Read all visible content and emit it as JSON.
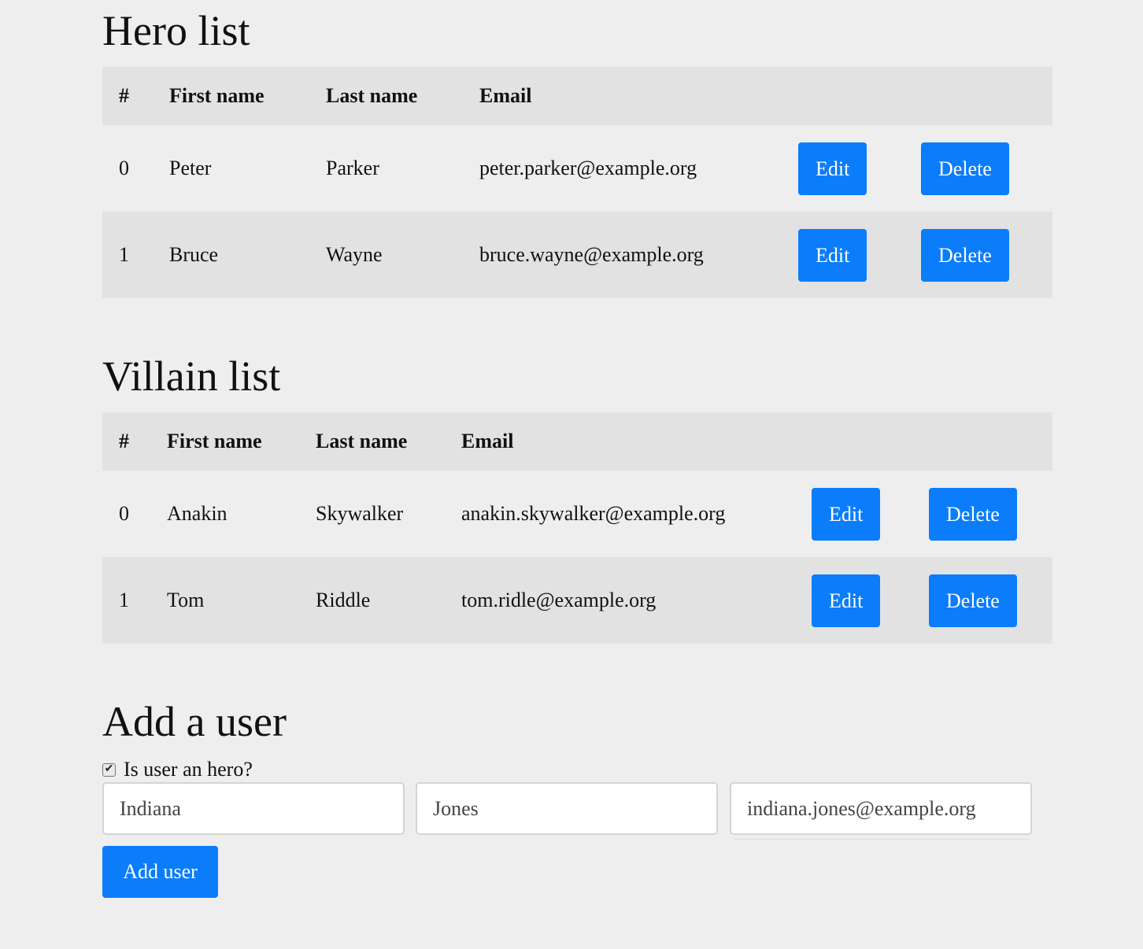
{
  "hero_section": {
    "title": "Hero list",
    "headers": [
      "#",
      "First name",
      "Last name",
      "Email"
    ],
    "rows": [
      {
        "index": "0",
        "first": "Peter",
        "last": "Parker",
        "email": "peter.parker@example.org",
        "edit": "Edit",
        "delete": "Delete"
      },
      {
        "index": "1",
        "first": "Bruce",
        "last": "Wayne",
        "email": "bruce.wayne@example.org",
        "edit": "Edit",
        "delete": "Delete"
      }
    ]
  },
  "villain_section": {
    "title": "Villain list",
    "headers": [
      "#",
      "First name",
      "Last name",
      "Email"
    ],
    "rows": [
      {
        "index": "0",
        "first": "Anakin",
        "last": "Skywalker",
        "email": "anakin.skywalker@example.org",
        "edit": "Edit",
        "delete": "Delete"
      },
      {
        "index": "1",
        "first": "Tom",
        "last": "Riddle",
        "email": "tom.ridle@example.org",
        "edit": "Edit",
        "delete": "Delete"
      }
    ]
  },
  "add_section": {
    "title": "Add a user",
    "hero_checkbox_label": "Is user an hero?",
    "hero_checked": true,
    "first_name_value": "Indiana",
    "last_name_value": "Jones",
    "email_value": "indiana.jones@example.org",
    "submit_label": "Add user"
  },
  "colors": {
    "accent": "#0b7dfb",
    "background": "#eeeeee",
    "header_row": "#e2e2e2"
  }
}
